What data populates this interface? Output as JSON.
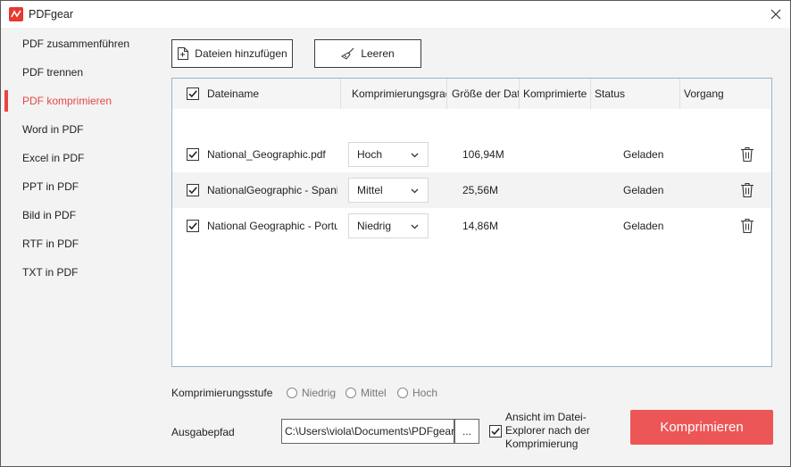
{
  "app": {
    "title": "PDFgear"
  },
  "sidebar": {
    "items": [
      {
        "label": "PDF zusammenführen",
        "active": false
      },
      {
        "label": "PDF trennen",
        "active": false
      },
      {
        "label": "PDF komprimieren",
        "active": true
      },
      {
        "label": "Word in PDF",
        "active": false
      },
      {
        "label": "Excel in PDF",
        "active": false
      },
      {
        "label": "PPT in PDF",
        "active": false
      },
      {
        "label": "Bild in PDF",
        "active": false
      },
      {
        "label": "RTF in PDF",
        "active": false
      },
      {
        "label": "TXT in PDF",
        "active": false
      }
    ]
  },
  "toolbar": {
    "add_files_label": "Dateien hinzufügen",
    "clear_label": "Leeren"
  },
  "table": {
    "headers": {
      "filename": "Dateiname",
      "compression": "Komprimierungsgrad",
      "size": "Größe der Datei",
      "compressed": "Komprimierte",
      "status": "Status",
      "action": "Vorgang"
    },
    "rows": [
      {
        "checked": true,
        "filename": "National_Geographic.pdf",
        "level": "Hoch",
        "size": "106,94M",
        "status": "Geladen"
      },
      {
        "checked": true,
        "filename": "NationalGeographic - Spanish.pdf",
        "level": "Mittel",
        "size": "25,56M",
        "status": "Geladen"
      },
      {
        "checked": true,
        "filename": "National Geographic - Portuguese.pdf",
        "level": "Niedrig",
        "size": "14,86M",
        "status": "Geladen"
      }
    ]
  },
  "compression_level": {
    "label": "Komprimierungsstufe",
    "options": [
      "Niedrig",
      "Mittel",
      "Hoch"
    ]
  },
  "output": {
    "label": "Ausgabepfad",
    "path": "C:\\Users\\viola\\Documents\\PDFgear",
    "browse_label": "...",
    "open_explorer_label_line1": "Ansicht im Datei-",
    "open_explorer_label_line2": "Explorer nach der",
    "open_explorer_label_line3": "Komprimierung",
    "open_explorer_checked": true
  },
  "actions": {
    "compress_label": "Komprimieren"
  },
  "colors": {
    "accent": "#ed5656",
    "active_nav": "#e64646",
    "table_border": "#8fb8c9"
  }
}
